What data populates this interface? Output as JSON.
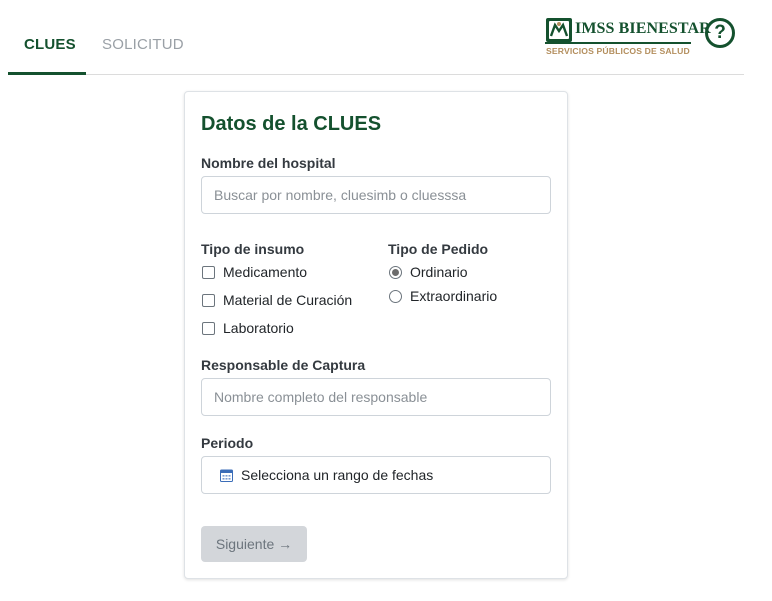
{
  "tabs": [
    {
      "label": "CLUES",
      "active": true
    },
    {
      "label": "SOLICITUD",
      "active": false
    }
  ],
  "logo": {
    "name": "IMSS BIENESTAR",
    "subtitle": "SERVICIOS PÚBLICOS DE SALUD",
    "brand_color": "#14512e",
    "accent_color": "#b38e5d"
  },
  "help": {
    "glyph": "?",
    "icon": "help-circle-icon"
  },
  "form": {
    "title": "Datos de la CLUES",
    "hospital": {
      "label": "Nombre del hospital",
      "placeholder": "Buscar por nombre, cluesimb o cluesssa",
      "value": ""
    },
    "tipo_insumo": {
      "label": "Tipo de insumo",
      "options": [
        {
          "label": "Medicamento",
          "checked": false
        },
        {
          "label": "Material de Curación",
          "checked": false
        },
        {
          "label": "Laboratorio",
          "checked": false
        }
      ]
    },
    "tipo_pedido": {
      "label": "Tipo de Pedido",
      "options": [
        {
          "label": "Ordinario",
          "selected": true
        },
        {
          "label": "Extraordinario",
          "selected": false
        }
      ]
    },
    "responsable": {
      "label": "Responsable de Captura",
      "placeholder": "Nombre completo del responsable",
      "value": ""
    },
    "periodo": {
      "label": "Periodo",
      "value": "Selecciona un rango de fechas",
      "icon": "calendar-icon"
    },
    "next_button": {
      "label": "Siguiente →",
      "disabled": true
    }
  }
}
